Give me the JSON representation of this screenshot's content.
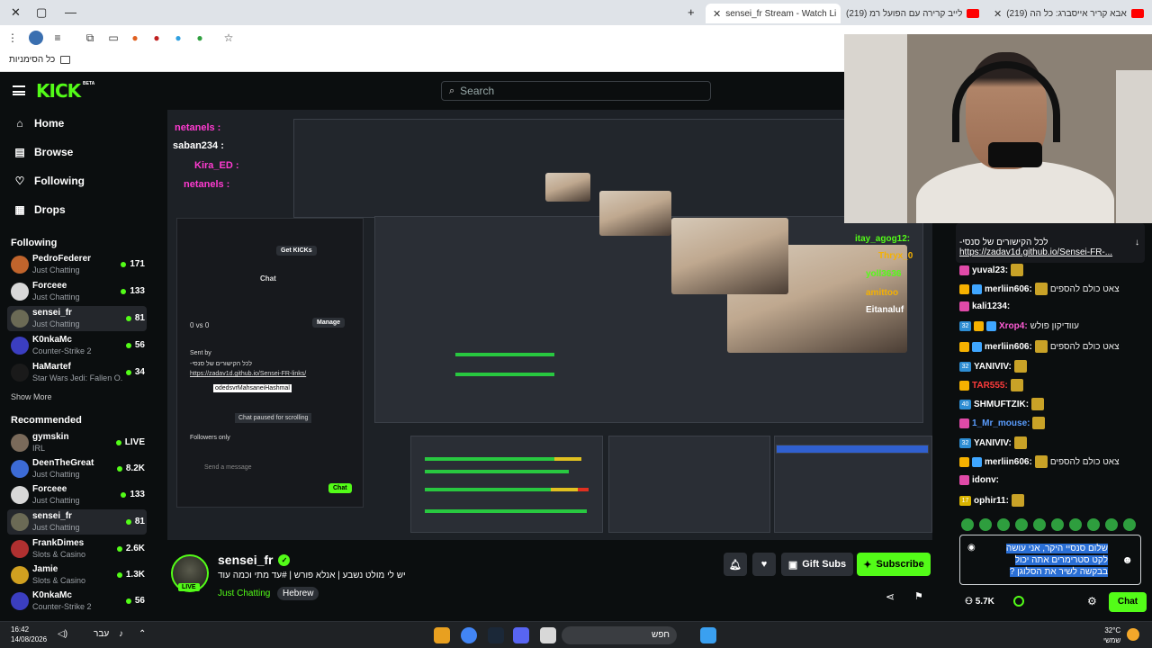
{
  "browser": {
    "tabs": [
      {
        "label": "sensei_fr Stream - Watch Li"
      },
      {
        "label": "(219) לייב קרירה עם הפועל רמ"
      },
      {
        "label": "(219) אבא קריר אייסברג: כל הה"
      }
    ],
    "bookmarks_label": "כל הסימניות"
  },
  "header": {
    "logo": "KICK",
    "logo_badge": "BETA",
    "search_placeholder": "Search"
  },
  "nav": [
    {
      "label": "Home",
      "icon": "home-icon"
    },
    {
      "label": "Browse",
      "icon": "browse-icon"
    },
    {
      "label": "Following",
      "icon": "heart-icon"
    },
    {
      "label": "Drops",
      "icon": "drops-icon"
    }
  ],
  "following": {
    "title": "Following",
    "channels": [
      {
        "name": "PedroFederer",
        "category": "Just Chatting",
        "viewers": "171",
        "color": "#c0642c"
      },
      {
        "name": "Forceee",
        "category": "Just Chatting",
        "viewers": "133",
        "color": "#d8d8d8"
      },
      {
        "name": "sensei_fr",
        "category": "Just Chatting",
        "viewers": "81",
        "color": "#6b6a55"
      },
      {
        "name": "K0nkaMc",
        "category": "Counter-Strike 2",
        "viewers": "56",
        "color": "#3b3ec0"
      },
      {
        "name": "HaMartef",
        "category": "Star Wars Jedi: Fallen O...",
        "viewers": "34",
        "color": "#1a1a1a"
      }
    ],
    "show_more": "Show More"
  },
  "recommended": {
    "title": "Recommended",
    "channels": [
      {
        "name": "gymskin",
        "category": "IRL",
        "viewers": "LIVE",
        "color": "#7a6a5a"
      },
      {
        "name": "DeenTheGreat",
        "category": "Just Chatting",
        "viewers": "8.2K",
        "color": "#3c6bd6"
      },
      {
        "name": "Forceee",
        "category": "Just Chatting",
        "viewers": "133",
        "color": "#d8d8d8"
      },
      {
        "name": "sensei_fr",
        "category": "Just Chatting",
        "viewers": "81",
        "color": "#6b6a55"
      },
      {
        "name": "FrankDimes",
        "category": "Slots & Casino",
        "viewers": "2.6K",
        "color": "#b03030"
      },
      {
        "name": "Jamie",
        "category": "Slots & Casino",
        "viewers": "1.3K",
        "color": "#d0a020"
      },
      {
        "name": "K0nkaMc",
        "category": "Counter-Strike 2",
        "viewers": "56",
        "color": "#3b3ec0"
      }
    ]
  },
  "inner_stream": {
    "overlay_names": [
      "netanels :",
      "saban234 :",
      "Kira_ED :",
      "netanels :"
    ],
    "chat_title": "Chat",
    "get_kicks": "Get KICKs",
    "manage": "Manage",
    "vs_text": "0 vs 0",
    "sent_by": "Sent by",
    "pinned_text": "לכל הקישורים של סנסי-",
    "pinned_link": "https://zadav1d.github.io/Sensei-FR-links/",
    "tooltip": "odedsvrMahsaneiHashmal",
    "paused": "Chat paused for scrolling",
    "followers_only": "Followers only",
    "send_placeholder": "Send a message",
    "chat_button": "Chat"
  },
  "stream": {
    "streamer": "sensei_fr",
    "live": "LIVE",
    "title": "יש לי מולט נשבע | אנלא פורש | #עד מתי וכמה עוד",
    "category": "Just Chatting",
    "tag": "Hebrew",
    "gift_subs": "Gift Subs",
    "subscribe": "Subscribe"
  },
  "chat": {
    "pinned_sent_by": "Sent by",
    "pinned_text": "לכל הקישורים של סנסי-",
    "pinned_link": "https://zadav1d.github.io/Sensei-FR-...",
    "overlay_lines": [
      {
        "user": "itay_agog12:",
        "color": "#53fc18"
      },
      {
        "user": "Thryx_0",
        "color": "#f5b100"
      },
      {
        "user": "yoll3636",
        "color": "#53fc18"
      },
      {
        "user": "amittoo",
        "color": "#f5b100"
      },
      {
        "user": "Eitanaluf",
        "color": "#ffffff"
      }
    ],
    "messages": [
      {
        "user": "yuval23:",
        "color": "#ffffff",
        "text": ""
      },
      {
        "user": "merliin606:",
        "color": "#ffffff",
        "text": "צאט כולם להספים"
      },
      {
        "user": "kali1234:",
        "color": "#ffffff",
        "text": ""
      },
      {
        "user": "Xrop4:",
        "color": "#ff5cd6",
        "text": "עוודיקון פולש"
      },
      {
        "user": "merliin606:",
        "color": "#ffffff",
        "text": "צאט כולם להספים"
      },
      {
        "user": "YANIVIV:",
        "color": "#ffffff",
        "text": ""
      },
      {
        "user": "TAR555:",
        "color": "#ff3b3b",
        "text": ""
      },
      {
        "user": "SHMUFTZIK:",
        "color": "#ffffff",
        "text": ""
      },
      {
        "user": "1_Mr_mouse:",
        "color": "#5a9dff",
        "text": ""
      },
      {
        "user": "YANIVIV:",
        "color": "#ffffff",
        "text": ""
      },
      {
        "user": "merliin606:",
        "color": "#ffffff",
        "text": "צאט כולם להספים"
      },
      {
        "user": "idonv:",
        "color": "#ffffff",
        "text": ""
      },
      {
        "user": "ophir11:",
        "color": "#ffffff",
        "text": ""
      }
    ],
    "input_text": "שלום סנסיי היקר, אני עושה לקט סטרימרים אתה יכול בבקשה לשיר את הסלוגן ?",
    "points": "5.7K",
    "send": "Chat"
  },
  "taskbar": {
    "time": "16:42",
    "date": "14/08/2026",
    "lang": "עבר",
    "search": "חפש",
    "temp": "32°C",
    "weather": "שמשי"
  },
  "colors": {
    "accent": "#53fc18",
    "background": "#0b0e0f"
  }
}
